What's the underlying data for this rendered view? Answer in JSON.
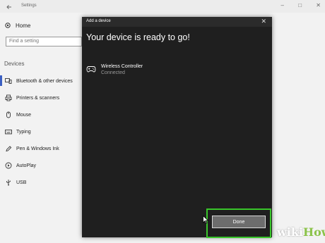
{
  "settings": {
    "title": "Settings",
    "home_label": "Home",
    "search_placeholder": "Find a setting",
    "section_label": "Devices",
    "nav_items": [
      {
        "label": "Bluetooth & other devices",
        "icon": "bluetooth-icon",
        "active": true
      },
      {
        "label": "Printers & scanners",
        "icon": "printer-icon",
        "active": false
      },
      {
        "label": "Mouse",
        "icon": "mouse-icon",
        "active": false
      },
      {
        "label": "Typing",
        "icon": "keyboard-icon",
        "active": false
      },
      {
        "label": "Pen & Windows Ink",
        "icon": "pen-icon",
        "active": false
      },
      {
        "label": "AutoPlay",
        "icon": "autoplay-icon",
        "active": false
      },
      {
        "label": "USB",
        "icon": "usb-icon",
        "active": false
      }
    ]
  },
  "dialog": {
    "title": "Add a device",
    "heading": "Your device is ready to go!",
    "device": {
      "name": "Wireless Controller",
      "status": "Connected",
      "icon": "gamepad-icon"
    },
    "done_label": "Done"
  },
  "watermark": {
    "part1": "wiki",
    "part2": "How"
  },
  "colors": {
    "dialog_bg": "#1f1f1f",
    "highlight": "#39c52b",
    "accent": "#3b5fc2"
  }
}
